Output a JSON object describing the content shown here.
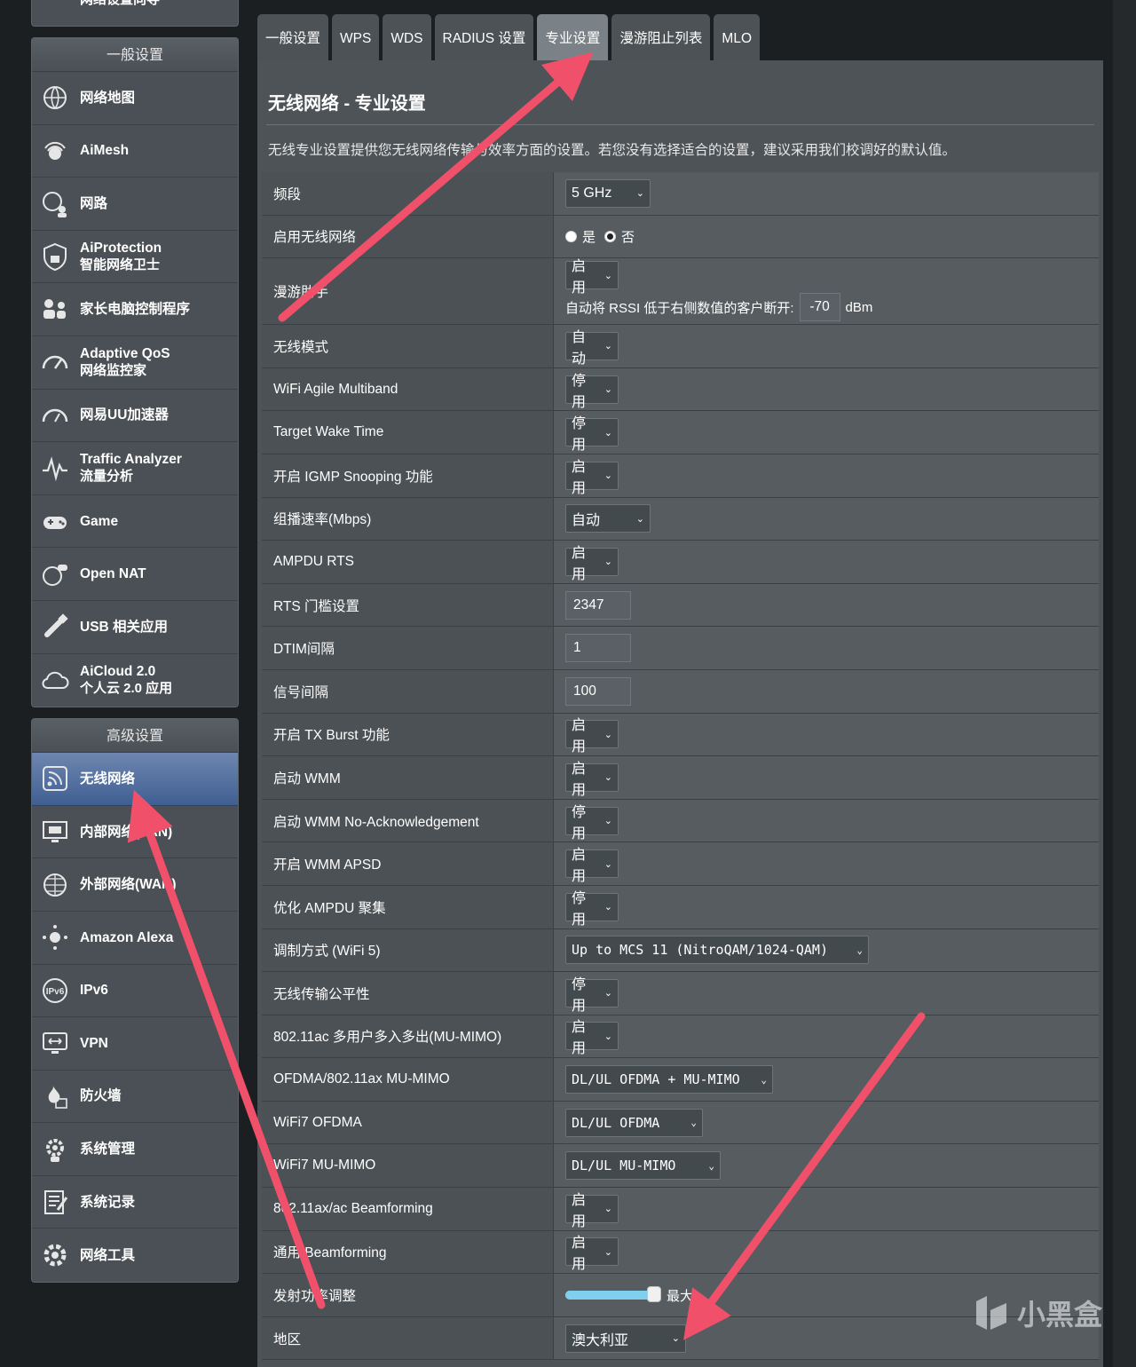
{
  "sidebar": {
    "top_stub_label": "网络设置向导",
    "general": {
      "header": "一般设置",
      "items": [
        {
          "icon": "globe-map-icon",
          "label": "网络地图",
          "sub": ""
        },
        {
          "icon": "aimesh-icon",
          "label": "AiMesh",
          "sub": ""
        },
        {
          "icon": "network-users-icon",
          "label": "网路",
          "sub": ""
        },
        {
          "icon": "shield-lock-icon",
          "label": "AiProtection",
          "sub": "智能网络卫士"
        },
        {
          "icon": "parental-control-icon",
          "label": "家长电脑控制程序",
          "sub": ""
        },
        {
          "icon": "speedometer-icon",
          "label": "Adaptive QoS",
          "sub": "网络监控家"
        },
        {
          "icon": "uu-accelerator-icon",
          "label": "网易UU加速器",
          "sub": ""
        },
        {
          "icon": "traffic-analyzer-icon",
          "label": "Traffic Analyzer",
          "sub": "流量分析"
        },
        {
          "icon": "gamepad-icon",
          "label": "Game",
          "sub": ""
        },
        {
          "icon": "open-nat-icon",
          "label": "Open NAT",
          "sub": ""
        },
        {
          "icon": "usb-icon",
          "label": "USB 相关应用",
          "sub": ""
        },
        {
          "icon": "cloud-icon",
          "label": "AiCloud 2.0",
          "sub": "个人云 2.0 应用"
        }
      ]
    },
    "advanced": {
      "header": "高级设置",
      "items": [
        {
          "icon": "wireless-icon",
          "label": "无线网络",
          "sub": "",
          "active": true
        },
        {
          "icon": "lan-icon",
          "label": "内部网络(LAN)",
          "sub": ""
        },
        {
          "icon": "wan-globe-icon",
          "label": "外部网络(WAN)",
          "sub": ""
        },
        {
          "icon": "alexa-icon",
          "label": "Amazon Alexa",
          "sub": ""
        },
        {
          "icon": "ipv6-icon",
          "label": "IPv6",
          "sub": ""
        },
        {
          "icon": "vpn-icon",
          "label": "VPN",
          "sub": ""
        },
        {
          "icon": "firewall-icon",
          "label": "防火墙",
          "sub": ""
        },
        {
          "icon": "admin-gear-icon",
          "label": "系统管理",
          "sub": ""
        },
        {
          "icon": "system-log-icon",
          "label": "系统记录",
          "sub": ""
        },
        {
          "icon": "network-tools-icon",
          "label": "网络工具",
          "sub": ""
        }
      ]
    }
  },
  "tabs": [
    {
      "label": "一般设置",
      "active": false
    },
    {
      "label": "WPS",
      "active": false
    },
    {
      "label": "WDS",
      "active": false
    },
    {
      "label": "RADIUS 设置",
      "active": false
    },
    {
      "label": "专业设置",
      "active": true
    },
    {
      "label": "漫游阻止列表",
      "active": false
    },
    {
      "label": "MLO",
      "active": false
    }
  ],
  "page": {
    "title": "无线网络 - 专业设置",
    "description": "无线专业设置提供您无线网络传输与效率方面的设置。若您没有选择适合的设置，建议采用我们校调好的默认值。"
  },
  "settings": {
    "band": {
      "label": "频段",
      "value": "5 GHz"
    },
    "enable_wireless": {
      "label": "启用无线网络",
      "yes": "是",
      "no": "否",
      "selected": "no"
    },
    "roaming": {
      "label": "漫游助手",
      "value": "启用",
      "rssi_text": "自动将 RSSI 低于右侧数值的客户断开:",
      "rssi_value": "-70",
      "unit": "dBm"
    },
    "wireless_mode": {
      "label": "无线模式",
      "value": "自动"
    },
    "agile_multiband": {
      "label": "WiFi Agile Multiband",
      "value": "停用"
    },
    "twt": {
      "label": "Target Wake Time",
      "value": "停用"
    },
    "igmp": {
      "label": "开启 IGMP Snooping 功能",
      "value": "启用"
    },
    "multicast_rate": {
      "label": "组播速率(Mbps)",
      "value": "自动"
    },
    "ampdu_rts": {
      "label": "AMPDU RTS",
      "value": "启用"
    },
    "rts_threshold": {
      "label": "RTS 门槛设置",
      "value": "2347"
    },
    "dtim": {
      "label": "DTIM间隔",
      "value": "1"
    },
    "beacon": {
      "label": "信号间隔",
      "value": "100"
    },
    "tx_burst": {
      "label": "开启 TX Burst 功能",
      "value": "启用"
    },
    "wmm": {
      "label": "启动 WMM",
      "value": "启用"
    },
    "wmm_noack": {
      "label": "启动 WMM No-Acknowledgement",
      "value": "停用"
    },
    "wmm_apsd": {
      "label": "开启 WMM APSD",
      "value": "启用"
    },
    "ampdu_agg": {
      "label": "优化 AMPDU 聚集",
      "value": "停用"
    },
    "modulation": {
      "label": "调制方式 (WiFi 5)",
      "value": "Up to MCS 11 (NitroQAM/1024-QAM)"
    },
    "airtime_fairness": {
      "label": "无线传输公平性",
      "value": "停用"
    },
    "mu_mimo_ac": {
      "label": "802.11ac 多用户多入多出(MU-MIMO)",
      "value": "启用"
    },
    "ofdma_ax": {
      "label": "OFDMA/802.11ax MU-MIMO",
      "value": "DL/UL OFDMA + MU-MIMO"
    },
    "wifi7_ofdma": {
      "label": "WiFi7 OFDMA",
      "value": "DL/UL OFDMA"
    },
    "wifi7_mumimo": {
      "label": "WiFi7 MU-MIMO",
      "value": "DL/UL MU-MIMO"
    },
    "beamforming_axac": {
      "label": "802.11ax/ac Beamforming",
      "value": "启用"
    },
    "beamforming_universal": {
      "label": "通用 Beamforming",
      "value": "启用"
    },
    "tx_power": {
      "label": "发射功率调整",
      "value_label": "最大",
      "level": 1.0
    },
    "region": {
      "label": "地区",
      "value": "澳大利亚"
    }
  },
  "watermark": "小黑盒",
  "colors": {
    "arrow": "#f0506a",
    "active_menu": "#4f6fa3",
    "panel": "#4d5357"
  }
}
